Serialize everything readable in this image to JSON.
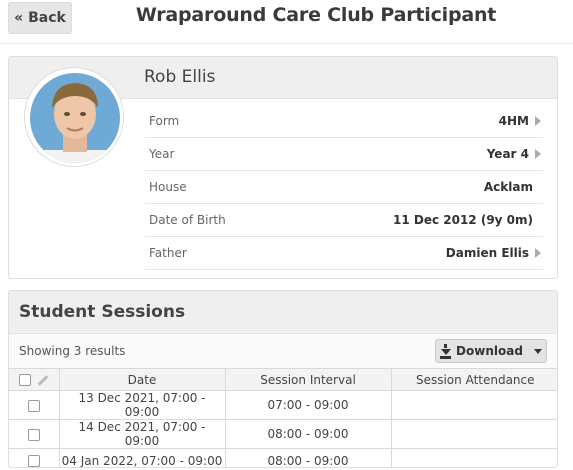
{
  "topbar": {
    "back_label": "« Back",
    "title": "Wraparound Care Club Participant"
  },
  "profile": {
    "name": "Rob Ellis",
    "details": [
      {
        "label": "Form",
        "value": "4HM",
        "link": true
      },
      {
        "label": "Year",
        "value": "Year 4",
        "link": true
      },
      {
        "label": "House",
        "value": "Acklam",
        "link": false
      },
      {
        "label": "Date of Birth",
        "value": "11 Dec 2012 (9y 0m)",
        "link": false
      },
      {
        "label": "Father",
        "value": "Damien Ellis",
        "link": true
      }
    ]
  },
  "sessions": {
    "title": "Student Sessions",
    "results_text": "Showing 3 results",
    "download_label": "Download",
    "columns": [
      "Date",
      "Session Interval",
      "Session Attendance"
    ],
    "rows": [
      {
        "date": "13 Dec 2021, 07:00 - 09:00",
        "interval": "07:00 - 09:00",
        "attendance": ""
      },
      {
        "date": "14 Dec 2021, 07:00 - 09:00",
        "interval": "08:00 - 09:00",
        "attendance": ""
      },
      {
        "date": "04 Jan 2022, 07:00 - 09:00",
        "interval": "08:00 - 09:00",
        "attendance": ""
      }
    ]
  },
  "colors": {
    "panel_header": "#efefef",
    "border": "#dedede",
    "caret": "#aaaaaa"
  }
}
